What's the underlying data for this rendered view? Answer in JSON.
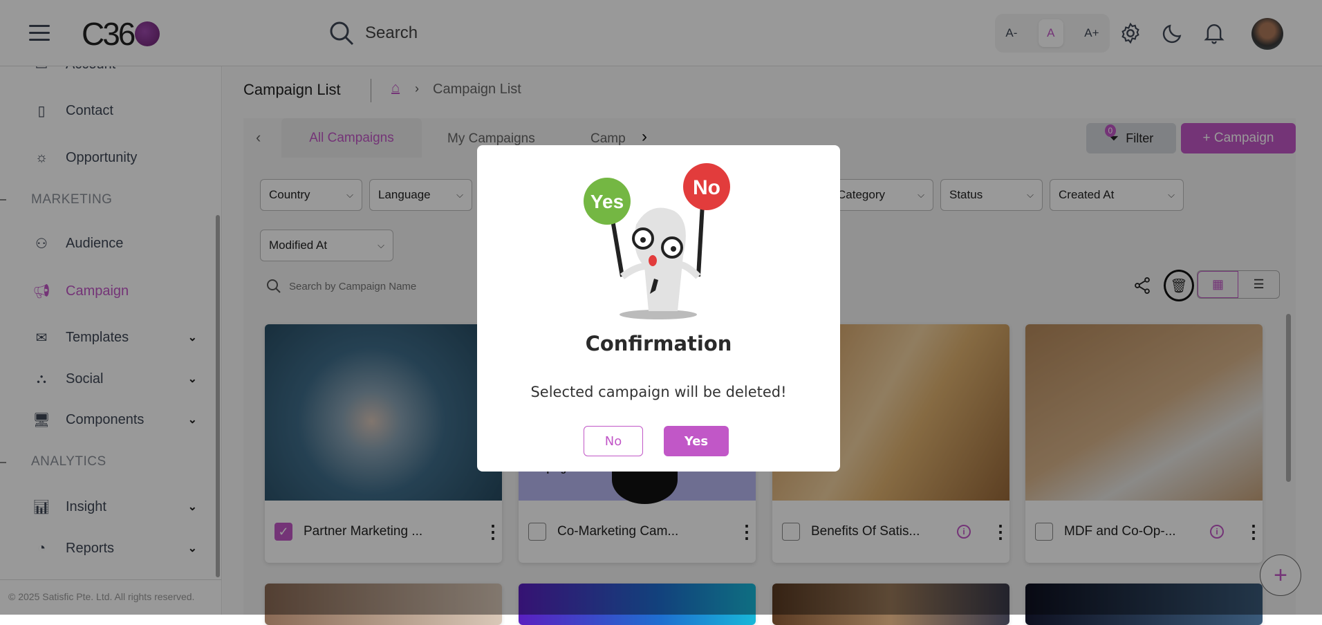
{
  "header": {
    "logo": "C36",
    "search_placeholder": "Search",
    "font_small": "A-",
    "font_normal": "A",
    "font_large": "A+"
  },
  "sidebar": {
    "items": [
      {
        "label": "Account",
        "icon": "account-icon"
      },
      {
        "label": "Contact",
        "icon": "contact-icon"
      },
      {
        "label": "Opportunity",
        "icon": "lightbulb-icon"
      },
      {
        "label": "Audience",
        "icon": "audience-icon"
      },
      {
        "label": "Campaign",
        "icon": "megaphone-icon",
        "active": true
      },
      {
        "label": "Templates",
        "icon": "templates-icon",
        "expandable": true
      },
      {
        "label": "Social",
        "icon": "social-icon",
        "expandable": true
      },
      {
        "label": "Components",
        "icon": "components-icon",
        "expandable": true
      },
      {
        "label": "Insight",
        "icon": "insight-icon",
        "expandable": true
      },
      {
        "label": "Reports",
        "icon": "reports-icon",
        "expandable": true
      }
    ],
    "sections": [
      "MARKETING",
      "ANALYTICS"
    ],
    "footer": "© 2025 Satisfic Pte. Ltd. All rights reserved."
  },
  "page": {
    "title": "Campaign List",
    "breadcrumb": "Campaign List"
  },
  "tabs": [
    "All Campaigns",
    "My Campaigns",
    "Camp"
  ],
  "actions": {
    "filter_label": "Filter",
    "filter_count": "0",
    "add_campaign_label": "+ Campaign"
  },
  "filters": [
    "Country",
    "Language",
    "Category",
    "Status",
    "Created At",
    "Modified At"
  ],
  "search": {
    "placeholder": "Search by Campaign Name"
  },
  "cards": [
    {
      "name": "Partner Marketing ...",
      "checked": true,
      "info": false
    },
    {
      "name": "Co-Marketing Cam...",
      "checked": false,
      "info": false,
      "image_text": "Campaigns"
    },
    {
      "name": "Benefits Of Satis...",
      "checked": false,
      "info": true
    },
    {
      "name": "MDF and Co-Op-...",
      "checked": false,
      "info": true
    }
  ],
  "modal": {
    "title": "Confirmation",
    "message": "Selected campaign will be deleted!",
    "no_label": "No",
    "yes_label": "Yes",
    "sign_yes": "Yes",
    "sign_no": "No"
  },
  "colors": {
    "accent": "#c157c7",
    "green": "#74b743",
    "red": "#e23c3c"
  }
}
